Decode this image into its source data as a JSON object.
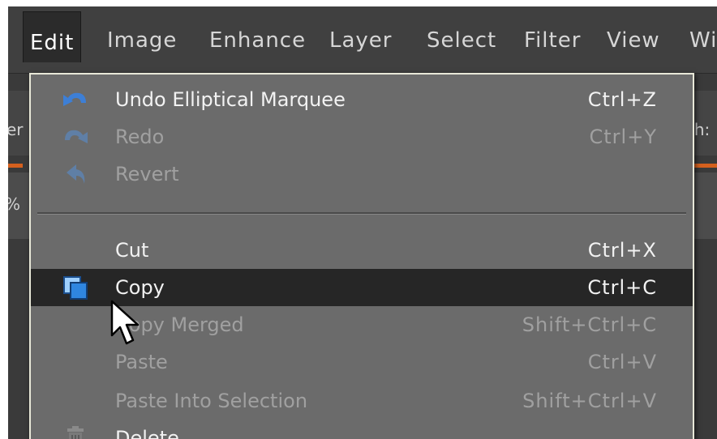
{
  "menubar": {
    "items": [
      {
        "label": "Edit"
      },
      {
        "label": "Image"
      },
      {
        "label": "Enhance"
      },
      {
        "label": "Layer"
      },
      {
        "label": "Select"
      },
      {
        "label": "Filter"
      },
      {
        "label": "View"
      },
      {
        "label": "Wi"
      }
    ]
  },
  "background": {
    "left_fragment": "er",
    "right_fragment": "th:",
    "left_fragment_2": "%"
  },
  "edit_menu": {
    "items": [
      {
        "label": "Undo Elliptical Marquee",
        "shortcut": "Ctrl+Z",
        "enabled": true,
        "icon": "undo-icon"
      },
      {
        "label": "Redo",
        "shortcut": "Ctrl+Y",
        "enabled": false,
        "icon": "redo-icon"
      },
      {
        "label": "Revert",
        "shortcut": "",
        "enabled": false,
        "icon": "revert-icon"
      },
      {
        "label": "Cut",
        "shortcut": "Ctrl+X",
        "enabled": true,
        "icon": ""
      },
      {
        "label": "Copy",
        "shortcut": "Ctrl+C",
        "enabled": true,
        "highlighted": true,
        "icon": "copy-icon"
      },
      {
        "label": "Copy Merged",
        "shortcut": "Shift+Ctrl+C",
        "enabled": false,
        "icon": ""
      },
      {
        "label": "Paste",
        "shortcut": "Ctrl+V",
        "enabled": false,
        "icon": ""
      },
      {
        "label": "Paste Into Selection",
        "shortcut": "Shift+Ctrl+V",
        "enabled": false,
        "icon": ""
      },
      {
        "label": "Delete",
        "shortcut": "",
        "enabled": true,
        "icon": "trash-icon"
      }
    ]
  },
  "colors": {
    "menu_bg": "#6b6b6b",
    "highlight_bg": "#262626",
    "menubar_bg": "#404040",
    "accent_orange": "#d4601e"
  }
}
